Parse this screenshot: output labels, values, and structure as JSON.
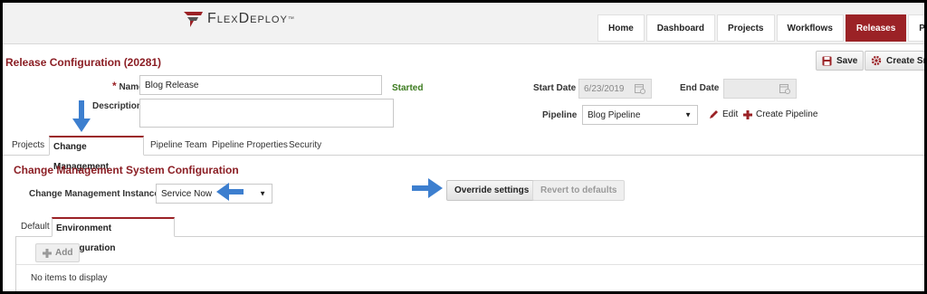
{
  "app": {
    "brand": "FlexDeploy",
    "trademark": "™"
  },
  "nav": {
    "items": [
      {
        "label": "Home",
        "active": false
      },
      {
        "label": "Dashboard",
        "active": false
      },
      {
        "label": "Projects",
        "active": false
      },
      {
        "label": "Workflows",
        "active": false
      },
      {
        "label": "Releases",
        "active": true
      },
      {
        "label": "Pipelines",
        "active": false
      }
    ]
  },
  "page": {
    "title": "Release Configuration (20281)"
  },
  "actions": {
    "save": "Save",
    "create": "Create Sn"
  },
  "form": {
    "name_label": "Name",
    "name_value": "Blog Release",
    "description_label": "Description",
    "description_value": "",
    "status": "Started",
    "start_date_label": "Start Date",
    "start_date_value": "6/23/2019",
    "end_date_label": "End Date",
    "end_date_value": "",
    "pipeline_label": "Pipeline",
    "pipeline_value": "Blog Pipeline",
    "edit_label": "Edit",
    "create_pipeline_label": "Create Pipeline"
  },
  "tabs": {
    "items": [
      {
        "label": "Projects",
        "active": false
      },
      {
        "label": "Change Management",
        "active": true
      },
      {
        "label": "Pipeline Team",
        "active": false
      },
      {
        "label": "Pipeline Properties",
        "active": false
      },
      {
        "label": "Security",
        "active": false
      }
    ]
  },
  "cms": {
    "section_title": "Change Management System Configuration",
    "instance_label": "Change Management Instance",
    "instance_value": "Service Now",
    "override_label": "Override settings",
    "revert_label": "Revert to defaults"
  },
  "subtabs": {
    "items": [
      {
        "label": "Default",
        "active": false
      },
      {
        "label": "Environment Configuration",
        "active": true
      }
    ]
  },
  "env": {
    "add_label": "Add",
    "empty_message": "No items to display"
  },
  "colors": {
    "accent": "#9b2226",
    "title": "#8b1e24",
    "status": "#3b7a1e",
    "arrow": "#3d7fcf"
  }
}
